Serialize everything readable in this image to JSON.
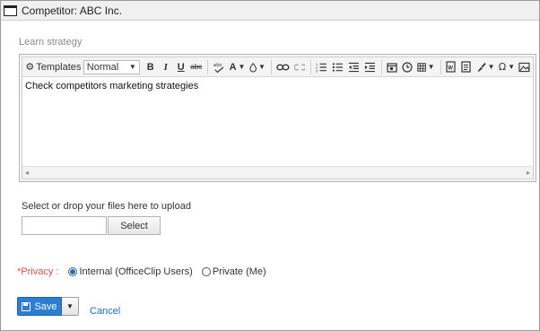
{
  "window": {
    "title": "Competitor: ABC Inc."
  },
  "strategy": {
    "label": "Learn strategy"
  },
  "editor": {
    "templates_label": "Templates",
    "format_value": "Normal",
    "bold_glyph": "B",
    "italic_glyph": "I",
    "underline_glyph": "U",
    "strike_glyph": "abc",
    "spellcheck_glyph": "abc",
    "font_color_glyph": "A",
    "special_char_glyph": "Ω",
    "content": "Check competitors marketing strategies"
  },
  "upload": {
    "label": "Select or drop your files here to upload",
    "file_value": "",
    "select_label": "Select"
  },
  "privacy": {
    "required_mark": "*",
    "label": "Privacy :",
    "options": [
      {
        "label": "Internal (OfficeClip Users)",
        "selected": true
      },
      {
        "label": "Private (Me)",
        "selected": false
      }
    ]
  },
  "actions": {
    "save_label": "Save",
    "cancel_label": "Cancel"
  },
  "colors": {
    "primary": "#2d7dd2",
    "link": "#1a6fc4",
    "required": "#e0504a"
  }
}
